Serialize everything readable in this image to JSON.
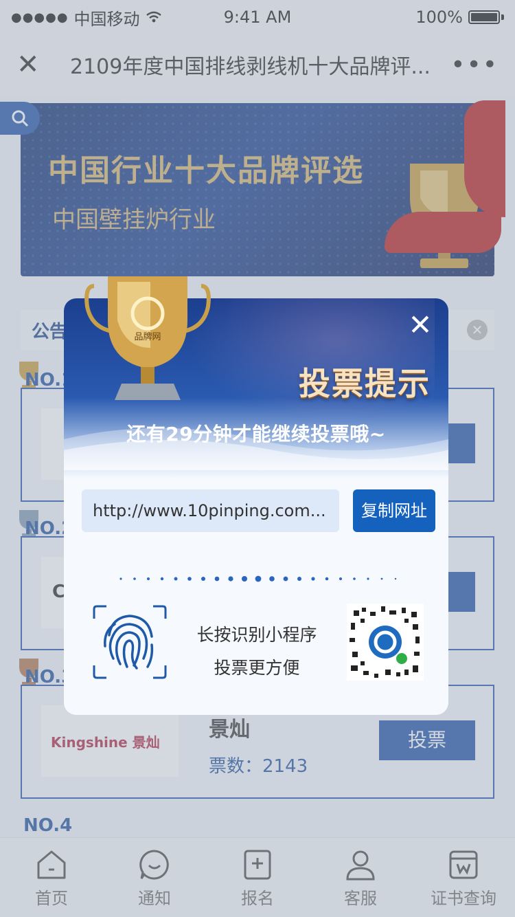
{
  "status_bar": {
    "carrier": "中国移动",
    "time": "9:41 AM",
    "battery": "100%"
  },
  "nav": {
    "title": "2109年度中国排线剥线机十大品牌评..."
  },
  "banner": {
    "title": "中国行业十大品牌评选",
    "subtitle": "中国壁挂炉行业"
  },
  "notice": {
    "label": "公告"
  },
  "ranking": [
    {
      "no": "NO.1",
      "name": "",
      "votes": "",
      "vote_label": "投票"
    },
    {
      "no": "NO.2",
      "name": "",
      "votes": "",
      "vote_label": "投票",
      "logo_text": "Cl"
    },
    {
      "no": "NO.3",
      "name": "景灿",
      "votes": "票数：2143",
      "vote_label": "投票",
      "logo_text": "Kingshine 景灿"
    },
    {
      "no": "NO.4"
    }
  ],
  "modal": {
    "title": "投票提示",
    "message": "还有29分钟才能继续投票哦~",
    "url": "http://www.10pinping.com...",
    "copy_label": "复制网址",
    "mini_program_line1": "长按识别小程序",
    "mini_program_line2": "投票更方便",
    "trophy_brand": "品牌网"
  },
  "tabs": [
    {
      "label": "首页",
      "icon": "home-icon"
    },
    {
      "label": "通知",
      "icon": "smile-chat-icon"
    },
    {
      "label": "报名",
      "icon": "add-doc-icon"
    },
    {
      "label": "客服",
      "icon": "service-icon"
    },
    {
      "label": "证书查询",
      "icon": "certificate-icon"
    }
  ],
  "colors": {
    "primary": "#1b4ea6",
    "copy_button": "#1462bd",
    "title_gold": "#f7e2c2"
  }
}
